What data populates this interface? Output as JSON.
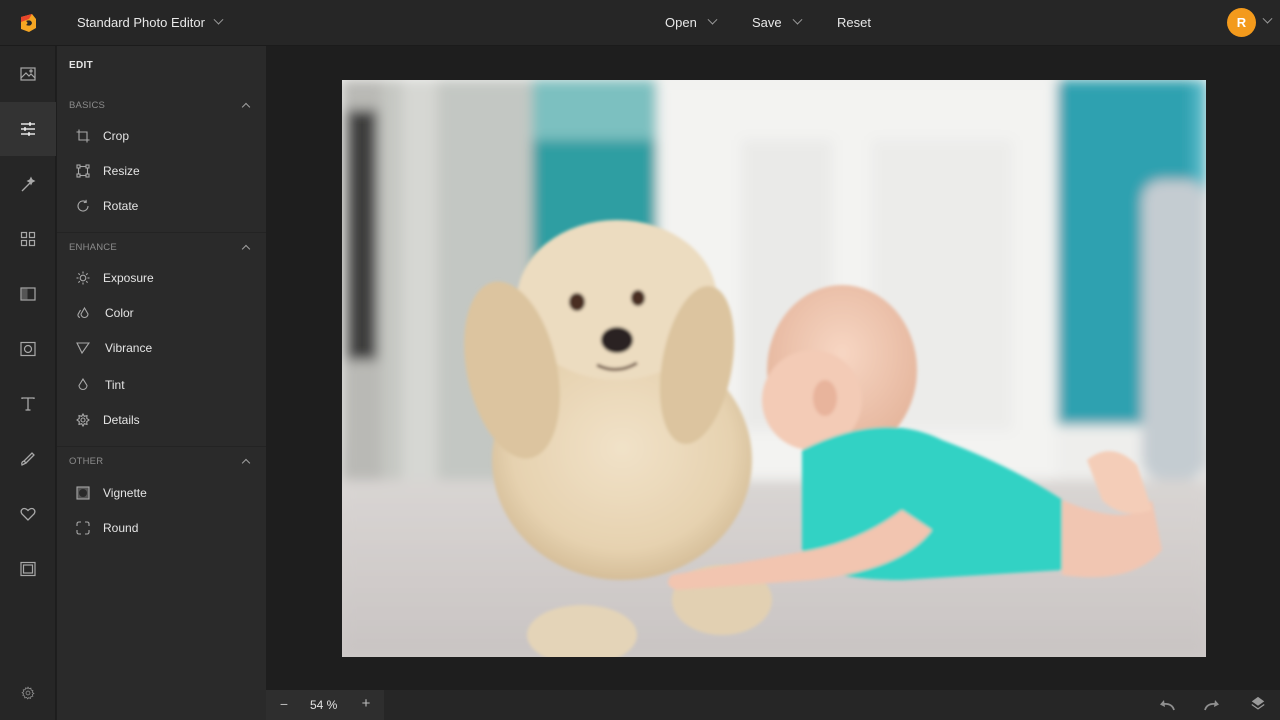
{
  "app": {
    "title": "Standard Photo Editor",
    "brand_color": "#f39a1c"
  },
  "topbar": {
    "menus": [
      {
        "label": "Open",
        "has_dropdown": true
      },
      {
        "label": "Save",
        "has_dropdown": true
      },
      {
        "label": "Reset",
        "has_dropdown": false
      }
    ],
    "user_initial": "R"
  },
  "rail": {
    "items": [
      {
        "icon": "image-icon",
        "active": false
      },
      {
        "icon": "sliders-icon",
        "active": true
      },
      {
        "icon": "magic-wand-icon",
        "active": false
      },
      {
        "icon": "grid-icon",
        "active": false
      },
      {
        "icon": "layout-icon",
        "active": false
      },
      {
        "icon": "frame-circle-icon",
        "active": false
      },
      {
        "icon": "text-icon",
        "active": false
      },
      {
        "icon": "brush-icon",
        "active": false
      },
      {
        "icon": "heart-icon",
        "active": false
      },
      {
        "icon": "border-frame-icon",
        "active": false
      }
    ],
    "settings_icon": "gear-icon"
  },
  "panel": {
    "title": "EDIT",
    "sections": [
      {
        "label": "BASICS",
        "expanded": true,
        "tools": [
          {
            "label": "Crop",
            "icon": "crop-icon"
          },
          {
            "label": "Resize",
            "icon": "resize-icon"
          },
          {
            "label": "Rotate",
            "icon": "rotate-icon"
          }
        ]
      },
      {
        "label": "ENHANCE",
        "expanded": true,
        "tools": [
          {
            "label": "Exposure",
            "icon": "sun-icon"
          },
          {
            "label": "Color",
            "icon": "drops-icon"
          },
          {
            "label": "Vibrance",
            "icon": "triangle-icon"
          },
          {
            "label": "Tint",
            "icon": "drop-icon"
          },
          {
            "label": "Details",
            "icon": "gear-star-icon"
          }
        ]
      },
      {
        "label": "OTHER",
        "expanded": true,
        "tools": [
          {
            "label": "Vignette",
            "icon": "vignette-icon"
          },
          {
            "label": "Round",
            "icon": "round-corners-icon"
          }
        ]
      }
    ]
  },
  "canvas": {
    "image_description": "Photo of a fluffy cream dog and a baby in a turquoise romper lying on a carpet"
  },
  "bottombar": {
    "zoom_minus": "−",
    "zoom_value": "54 %",
    "zoom_plus": "+"
  }
}
